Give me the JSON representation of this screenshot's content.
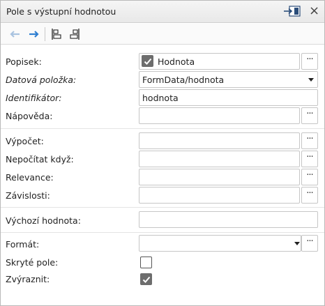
{
  "panel": {
    "title": "Pole s výstupní hodnotou",
    "close_label": "×"
  },
  "toolbar": {
    "icons": [
      "arrow-left-icon",
      "arrow-right-icon",
      "align-left-icon",
      "align-right-icon"
    ]
  },
  "fields": {
    "popisek": {
      "label": "Popisek:",
      "value": "Hodnota",
      "checked": true,
      "button": "···"
    },
    "datova_polozka": {
      "label": "Datová položka:",
      "value": "FormData/hodnota"
    },
    "identifikator": {
      "label": "Identifikátor:",
      "value": "hodnota"
    },
    "napoveda": {
      "label": "Nápověda:",
      "value": "",
      "button": "···"
    },
    "vypocet": {
      "label": "Výpočet:",
      "value": "",
      "button": "···"
    },
    "nepocitat": {
      "label": "Nepočítat když:",
      "value": "",
      "button": "···"
    },
    "relevance": {
      "label": "Relevance:",
      "value": "",
      "button": "···"
    },
    "zavislosti": {
      "label": "Závislosti:",
      "value": "",
      "button": "···"
    },
    "vychozi": {
      "label": "Výchozí hodnota:",
      "value": ""
    },
    "format": {
      "label": "Formát:",
      "value": "",
      "button": "···"
    },
    "skryte": {
      "label": "Skryté pole:",
      "checked": false
    },
    "zvyraznit": {
      "label": "Zvýraznit:",
      "checked": true
    }
  },
  "colors": {
    "accent_blue": "#2f7fd1",
    "checkbox_checked": "#6d6d6d"
  }
}
